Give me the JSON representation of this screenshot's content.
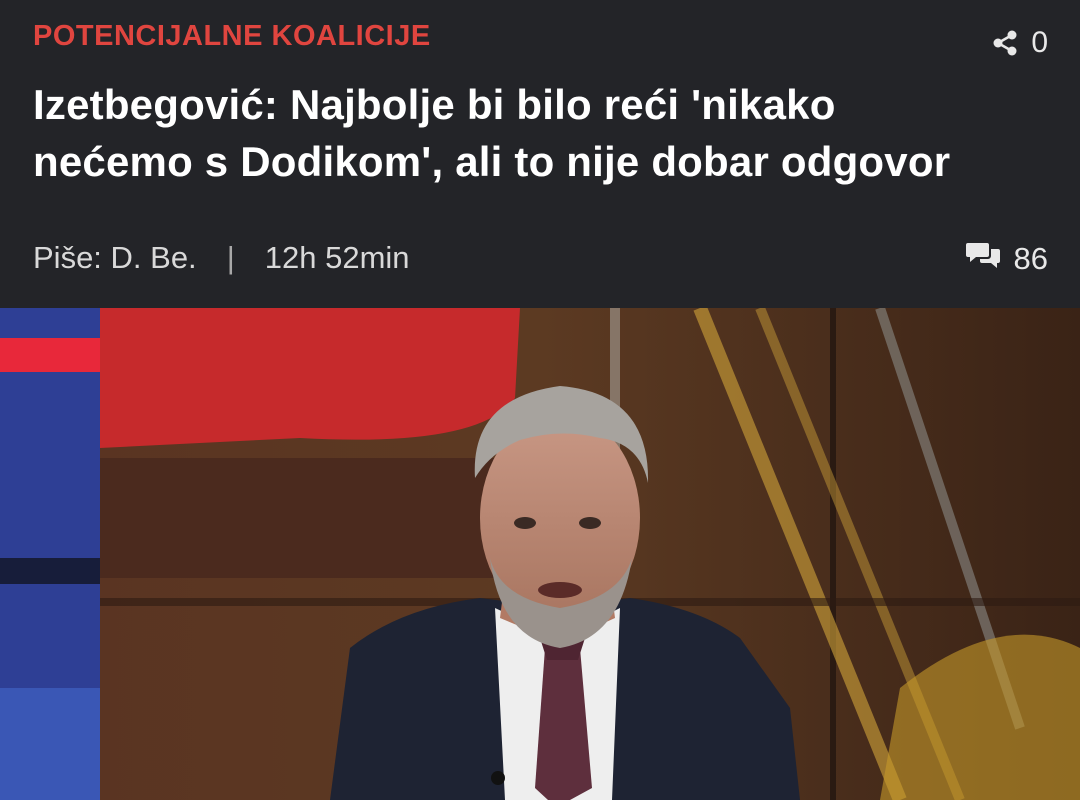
{
  "article": {
    "category": "POTENCIJALNE KOALICIJE",
    "category_color": "#e0453f",
    "share_count": "0",
    "headline_line1": "Izetbegović: Najbolje bi bilo reći 'nikako",
    "headline_line2": "nećemo s Dodikom', ali to nije dobar odgovor",
    "author": "Piše: D. Be.",
    "separator": "|",
    "time_ago": "12h 52min",
    "comment_count": "86"
  },
  "icons": {
    "share": "share-icon",
    "comments": "comments-icon"
  },
  "colors": {
    "background": "#232428",
    "text": "#ffffff",
    "meta_text": "#d9d9d9"
  }
}
